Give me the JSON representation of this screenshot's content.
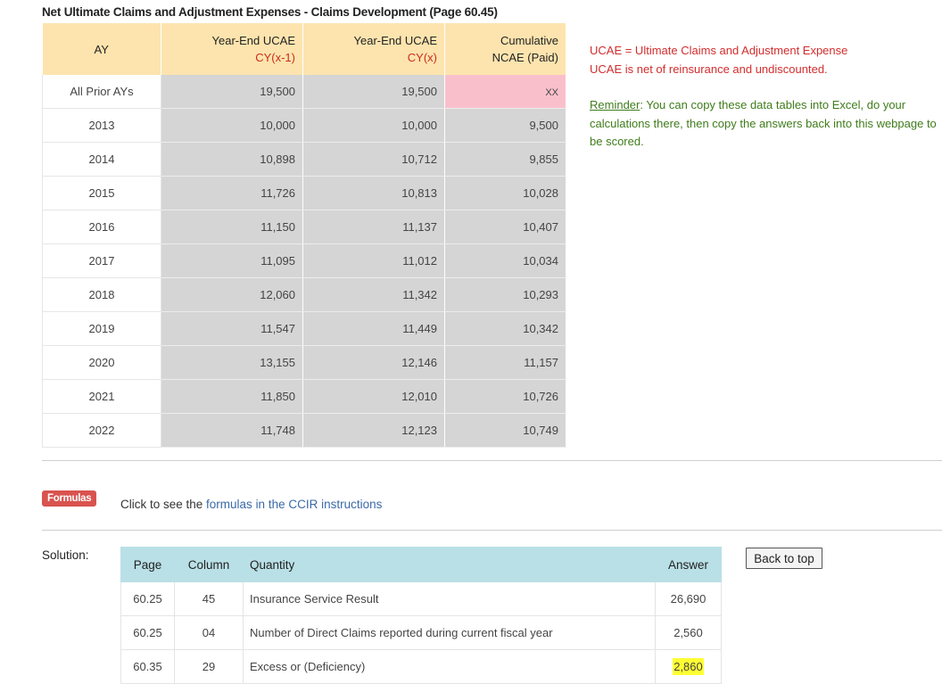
{
  "page_title": "Net Ultimate Claims and Adjustment Expenses - Claims Development (Page 60.45)",
  "claims_table": {
    "headers": {
      "ay": "AY",
      "col1_line1": "Year-End UCAE",
      "col1_line2": "CY(x-1)",
      "col2_line1": "Year-End UCAE",
      "col2_line2": "CY(x)",
      "col3_line1": "Cumulative",
      "col3_line2": "NCAE (Paid)"
    },
    "rows": [
      {
        "ay": "All Prior AYs",
        "prev": "19,500",
        "curr": "19,500",
        "paid": "XX"
      },
      {
        "ay": "2013",
        "prev": "10,000",
        "curr": "10,000",
        "paid": "9,500"
      },
      {
        "ay": "2014",
        "prev": "10,898",
        "curr": "10,712",
        "paid": "9,855"
      },
      {
        "ay": "2015",
        "prev": "11,726",
        "curr": "10,813",
        "paid": "10,028"
      },
      {
        "ay": "2016",
        "prev": "11,150",
        "curr": "11,137",
        "paid": "10,407"
      },
      {
        "ay": "2017",
        "prev": "11,095",
        "curr": "11,012",
        "paid": "10,034"
      },
      {
        "ay": "2018",
        "prev": "12,060",
        "curr": "11,342",
        "paid": "10,293"
      },
      {
        "ay": "2019",
        "prev": "11,547",
        "curr": "11,449",
        "paid": "10,342"
      },
      {
        "ay": "2020",
        "prev": "13,155",
        "curr": "12,146",
        "paid": "11,157"
      },
      {
        "ay": "2021",
        "prev": "11,850",
        "curr": "12,010",
        "paid": "10,726"
      },
      {
        "ay": "2022",
        "prev": "11,748",
        "curr": "12,123",
        "paid": "10,749"
      }
    ]
  },
  "notes": {
    "definition": "UCAE = Ultimate Claims and Adjustment Expense",
    "net_note": "UCAE is net of reinsurance and undiscounted.",
    "reminder_label": "Reminder",
    "reminder_text": ": You can copy these data tables into Excel, do your calculations there, then copy the answers back into this webpage to be scored."
  },
  "formulas": {
    "button_label": "Formulas",
    "prefix": "Click to see the ",
    "link_text": "formulas in the CCIR instructions"
  },
  "solution": {
    "label": "Solution:",
    "headers": {
      "page": "Page",
      "column": "Column",
      "quantity": "Quantity",
      "answer": "Answer"
    },
    "rows": [
      {
        "page": "60.25",
        "column": "45",
        "quantity": "Insurance Service Result",
        "answer": "26,690"
      },
      {
        "page": "60.25",
        "column": "04",
        "quantity": "Number of Direct Claims reported during current fiscal year",
        "answer": "2,560"
      },
      {
        "page": "60.35",
        "column": "29",
        "quantity": "Excess or (Deficiency)",
        "answer": "2,860"
      }
    ]
  },
  "back_to_top_label": "Back to top",
  "colors": {
    "header_bg": "#fde4ae",
    "cy_red": "#cc2b1d",
    "cell_gray": "#d5d5d5",
    "pink_cell": "#f9c0cc",
    "definition_red": "#d32d2d",
    "reminder_green": "#3f7c1b",
    "formulas_button": "#d9534f",
    "solution_header": "#b9e0e6",
    "highlight": "#ffff33"
  }
}
